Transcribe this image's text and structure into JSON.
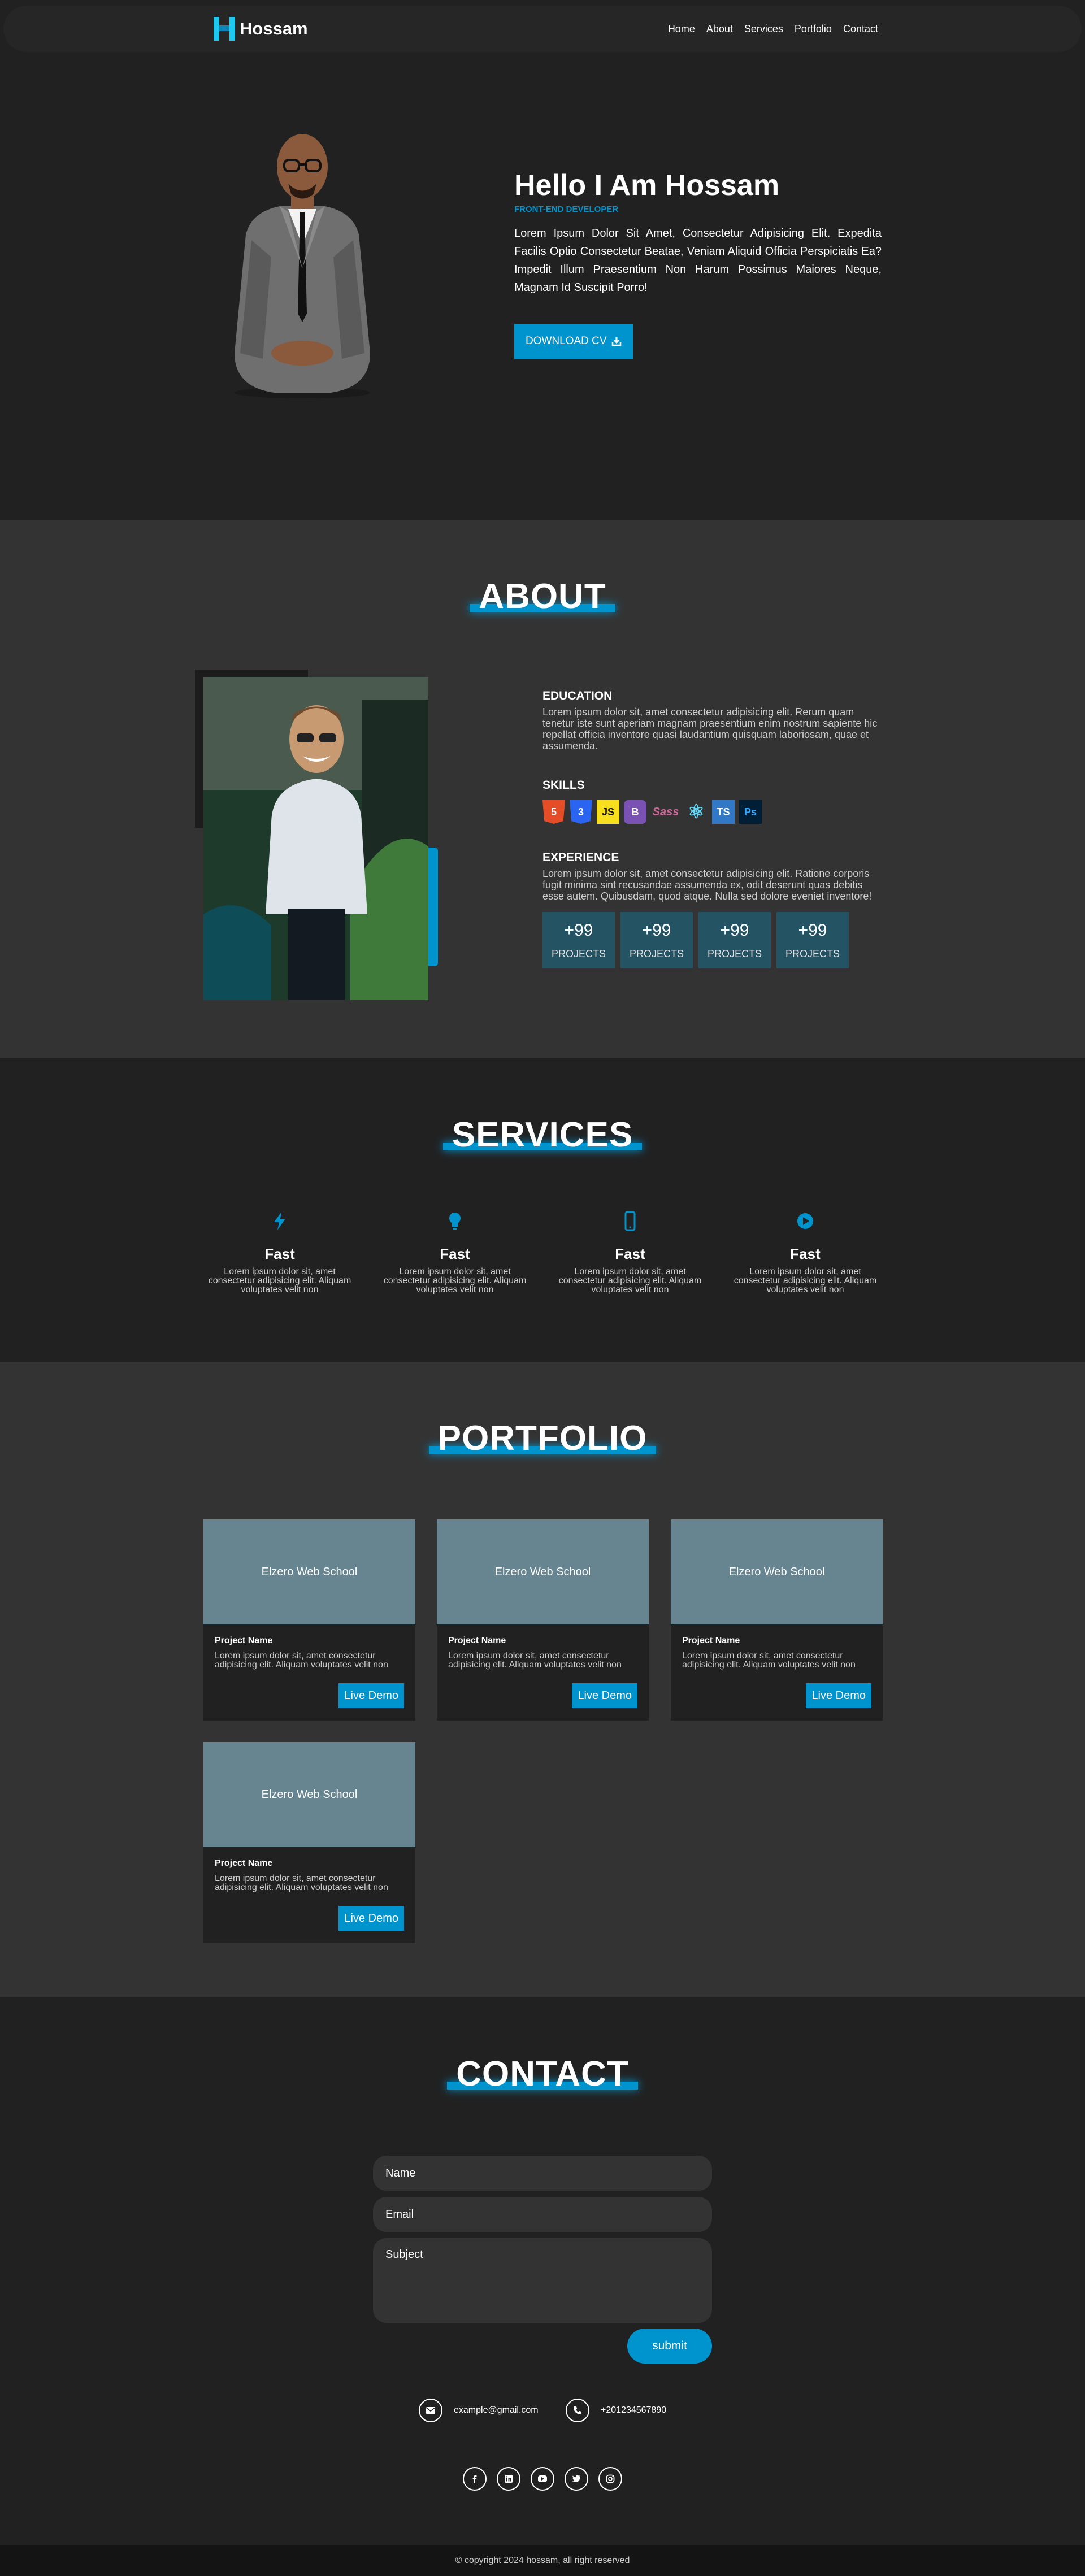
{
  "nav": {
    "brand": "Hossam",
    "links": [
      "Home",
      "About",
      "Services",
      "Portfolio",
      "Contact"
    ]
  },
  "hero": {
    "title": "Hello I Am Hossam",
    "subtitle": "FRONT-END DEVELOPER",
    "description": "Lorem Ipsum Dolor Sit Amet, Consectetur Adipisicing Elit. Expedita Facilis Optio Consectetur Beatae, Veniam Aliquid Officia Perspiciatis Ea? Impedit Illum Praesentium Non Harum Possimus Maiores Neque, Magnam Id Suscipit Porro!",
    "cv_button": "DOWNLOAD CV"
  },
  "about": {
    "title": "ABOUT",
    "education_title": "EDUCATION",
    "education_text": "Lorem ipsum dolor sit, amet consectetur adipisicing elit. Rerum quam tenetur iste sunt aperiam magnam praesentium enim nostrum sapiente hic repellat officia inventore quasi laudantium quisquam laboriosam, quae et assumenda.",
    "skills_title": "SKILLS",
    "skills": [
      {
        "name": "html5-icon",
        "label": "5",
        "color": "#e44d26"
      },
      {
        "name": "css3-icon",
        "label": "3",
        "color": "#2965f1"
      },
      {
        "name": "javascript-icon",
        "label": "JS",
        "color": "#f7df1e"
      },
      {
        "name": "bootstrap-icon",
        "label": "B",
        "color": "#7952b3"
      },
      {
        "name": "sass-icon",
        "label": "Sass",
        "color": "#cd6799"
      },
      {
        "name": "react-icon",
        "label": "⚛",
        "color": "#61dafb"
      },
      {
        "name": "typescript-icon",
        "label": "TS",
        "color": "#3178c6"
      },
      {
        "name": "photoshop-icon",
        "label": "Ps",
        "color": "#31a8ff"
      }
    ],
    "experience_title": "EXPERIENCE",
    "experience_text": "Lorem ipsum dolor sit, amet consectetur adipisicing elit. Ratione corporis fugit minima sint recusandae assumenda ex, odit deserunt quas debitis esse autem. Quibusdam, quod atque. Nulla sed dolore eveniet inventore!",
    "stats": [
      {
        "value": "+99",
        "label": "PROJECTS"
      },
      {
        "value": "+99",
        "label": "PROJECTS"
      },
      {
        "value": "+99",
        "label": "PROJECTS"
      },
      {
        "value": "+99",
        "label": "PROJECTS"
      }
    ]
  },
  "services": {
    "title": "SERVICES",
    "items": [
      {
        "icon": "bolt-icon",
        "title": "Fast",
        "desc": "Lorem ipsum dolor sit, amet consectetur adipisicing elit. Aliquam voluptates velit non"
      },
      {
        "icon": "lightbulb-icon",
        "title": "Fast",
        "desc": "Lorem ipsum dolor sit, amet consectetur adipisicing elit. Aliquam voluptates velit non"
      },
      {
        "icon": "mobile-icon",
        "title": "Fast",
        "desc": "Lorem ipsum dolor sit, amet consectetur adipisicing elit. Aliquam voluptates velit non"
      },
      {
        "icon": "play-circle-icon",
        "title": "Fast",
        "desc": "Lorem ipsum dolor sit, amet consectetur adipisicing elit. Aliquam voluptates velit non"
      }
    ]
  },
  "portfolio": {
    "title": "PORTFOLIO",
    "projects": [
      {
        "thumb": "Elzero Web School",
        "name": "Project Name",
        "desc": "Lorem ipsum dolor sit, amet consectetur adipisicing elit. Aliquam voluptates velit non",
        "button": "Live Demo"
      },
      {
        "thumb": "Elzero Web School",
        "name": "Project Name",
        "desc": "Lorem ipsum dolor sit, amet consectetur adipisicing elit. Aliquam voluptates velit non",
        "button": "Live Demo"
      },
      {
        "thumb": "Elzero Web School",
        "name": "Project Name",
        "desc": "Lorem ipsum dolor sit, amet consectetur adipisicing elit. Aliquam voluptates velit non",
        "button": "Live Demo"
      },
      {
        "thumb": "Elzero Web School",
        "name": "Project Name",
        "desc": "Lorem ipsum dolor sit, amet consectetur adipisicing elit. Aliquam voluptates velit non",
        "button": "Live Demo"
      }
    ]
  },
  "contact": {
    "title": "CONTACT",
    "name_placeholder": "Name",
    "email_placeholder": "Email",
    "subject_placeholder": "Subject",
    "submit": "submit",
    "email": "example@gmail.com",
    "phone": "+201234567890",
    "socials": [
      "facebook-icon",
      "linkedin-icon",
      "youtube-icon",
      "twitter-icon",
      "instagram-icon"
    ]
  },
  "footer": {
    "copyright": "© copyright 2024 hossam, all right reserved"
  },
  "colors": {
    "accent": "#0094cf",
    "background": "#212121",
    "section_alt": "#333333"
  }
}
